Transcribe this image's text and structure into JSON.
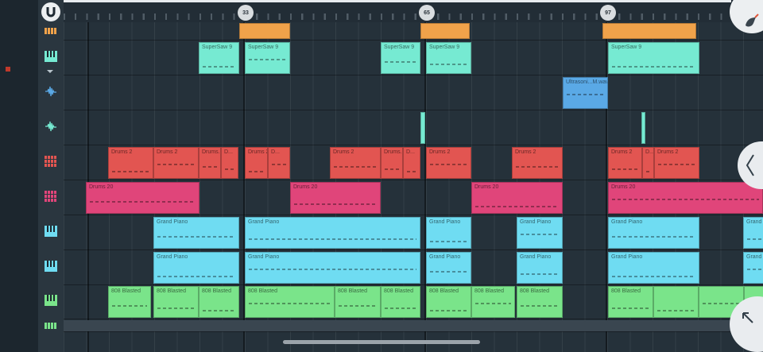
{
  "ruler": {
    "markers": [
      "33",
      "65",
      "97"
    ]
  },
  "colors": {
    "orange": "#f0a24a",
    "teal": "#76ead2",
    "blue": "#5aa9e6",
    "red": "#e25551",
    "pink": "#e0457a",
    "cyan": "#6fdcf2",
    "green": "#7ae48a"
  },
  "tracks": [
    {
      "icon": "drum-pattern-icon",
      "color": "#f0a24a"
    },
    {
      "icon": "piano-keys-icon",
      "color": "#76ead2"
    },
    {
      "icon": "waveform-icon",
      "color": "#5aa9e6"
    },
    {
      "icon": "waveform-icon",
      "color": "#76ead2"
    },
    {
      "icon": "drum-grid-icon",
      "color": "#e25551"
    },
    {
      "icon": "drum-grid-icon",
      "color": "#e0457a"
    },
    {
      "icon": "piano-keys-icon",
      "color": "#6fdcf2"
    },
    {
      "icon": "piano-keys-icon",
      "color": "#6fdcf2"
    },
    {
      "icon": "piano-keys-icon",
      "color": "#7ae48a"
    },
    {
      "icon": "drum-pattern-icon",
      "color": "#7ae48a"
    }
  ],
  "clip_labels": {
    "supersaw": "SuperSaw 9",
    "ultrasonic": "Ultrasoni...M.wav",
    "drums2": "Drums 2",
    "drums2_short": "Drums...",
    "drums2_d": "D...",
    "drums20": "Drums 20",
    "grandpiano": "Grand Piano",
    "blasted": "808 Blasted"
  }
}
